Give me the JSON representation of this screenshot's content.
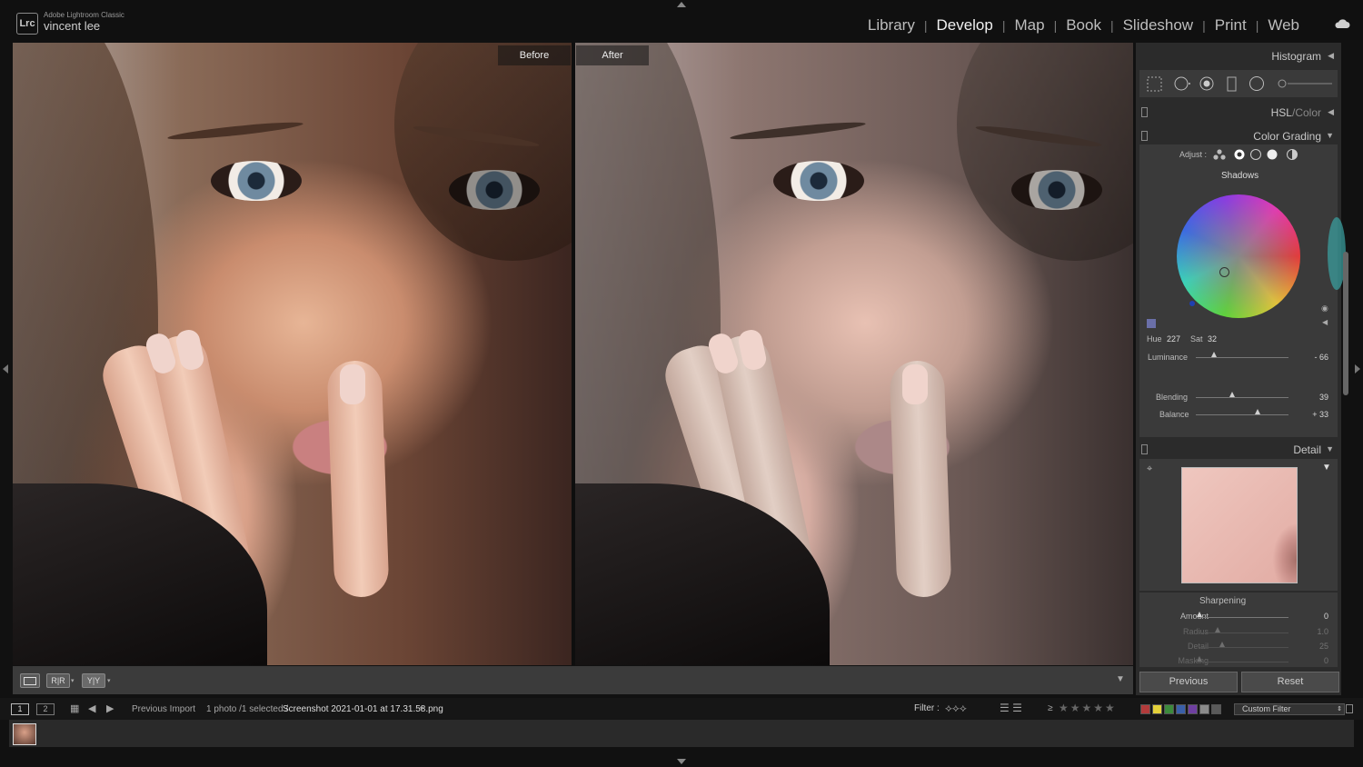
{
  "app": {
    "name": "Adobe Lightroom Classic",
    "user": "vincent lee",
    "logo": "Lrc"
  },
  "modules": [
    {
      "label": "Library",
      "active": false
    },
    {
      "label": "Develop",
      "active": true
    },
    {
      "label": "Map",
      "active": false
    },
    {
      "label": "Book",
      "active": false
    },
    {
      "label": "Slideshow",
      "active": false
    },
    {
      "label": "Print",
      "active": false
    },
    {
      "label": "Web",
      "active": false
    }
  ],
  "view": {
    "before_label": "Before",
    "after_label": "After"
  },
  "toolbar": {
    "view1": "",
    "view2": "R|R",
    "view3": "Y|Y"
  },
  "panels": {
    "histogram": {
      "title": "Histogram"
    },
    "hsl": {
      "title_a": "HSL",
      "title_b": "/",
      "title_c": "Color"
    },
    "color_grading": {
      "title": "Color Grading",
      "adjust_label": "Adjust :",
      "section": "Shadows",
      "hue_label": "Hue",
      "hue": "227",
      "sat_label": "Sat",
      "sat": "32",
      "luminance_label": "Luminance",
      "luminance": "- 66",
      "blending_label": "Blending",
      "blending": "39",
      "balance_label": "Balance",
      "balance": "+ 33",
      "swatch_color": "#6a6fa8",
      "luminance_level": 0.2,
      "blending_level": 0.39,
      "balance_level": 0.665
    },
    "detail": {
      "title": "Detail",
      "sharpening_label": "Sharpening",
      "rows": [
        {
          "label": "Amount",
          "value": "0",
          "level": 0.0
        },
        {
          "label": "Radius",
          "value": "1.0",
          "level": 0.2
        },
        {
          "label": "Detail",
          "value": "25",
          "level": 0.25
        },
        {
          "label": "Masking",
          "value": "0",
          "level": 0.0
        }
      ]
    },
    "buttons": {
      "previous": "Previous",
      "reset": "Reset"
    }
  },
  "filmbar": {
    "page1": "1",
    "page2": "2",
    "source": "Previous Import",
    "count": "1 photo /1 selected /",
    "filename": "Screenshot 2021-01-01 at 17.31.58.png",
    "filter_label": "Filter :",
    "rating_op": "≥",
    "custom_filter": "Custom Filter",
    "label_colors": [
      "#b23b3b",
      "#e3d13a",
      "#3c8a3c",
      "#3a5fa8",
      "#6e3fa0",
      "#8a8a8a",
      "#5a5a5a"
    ]
  }
}
